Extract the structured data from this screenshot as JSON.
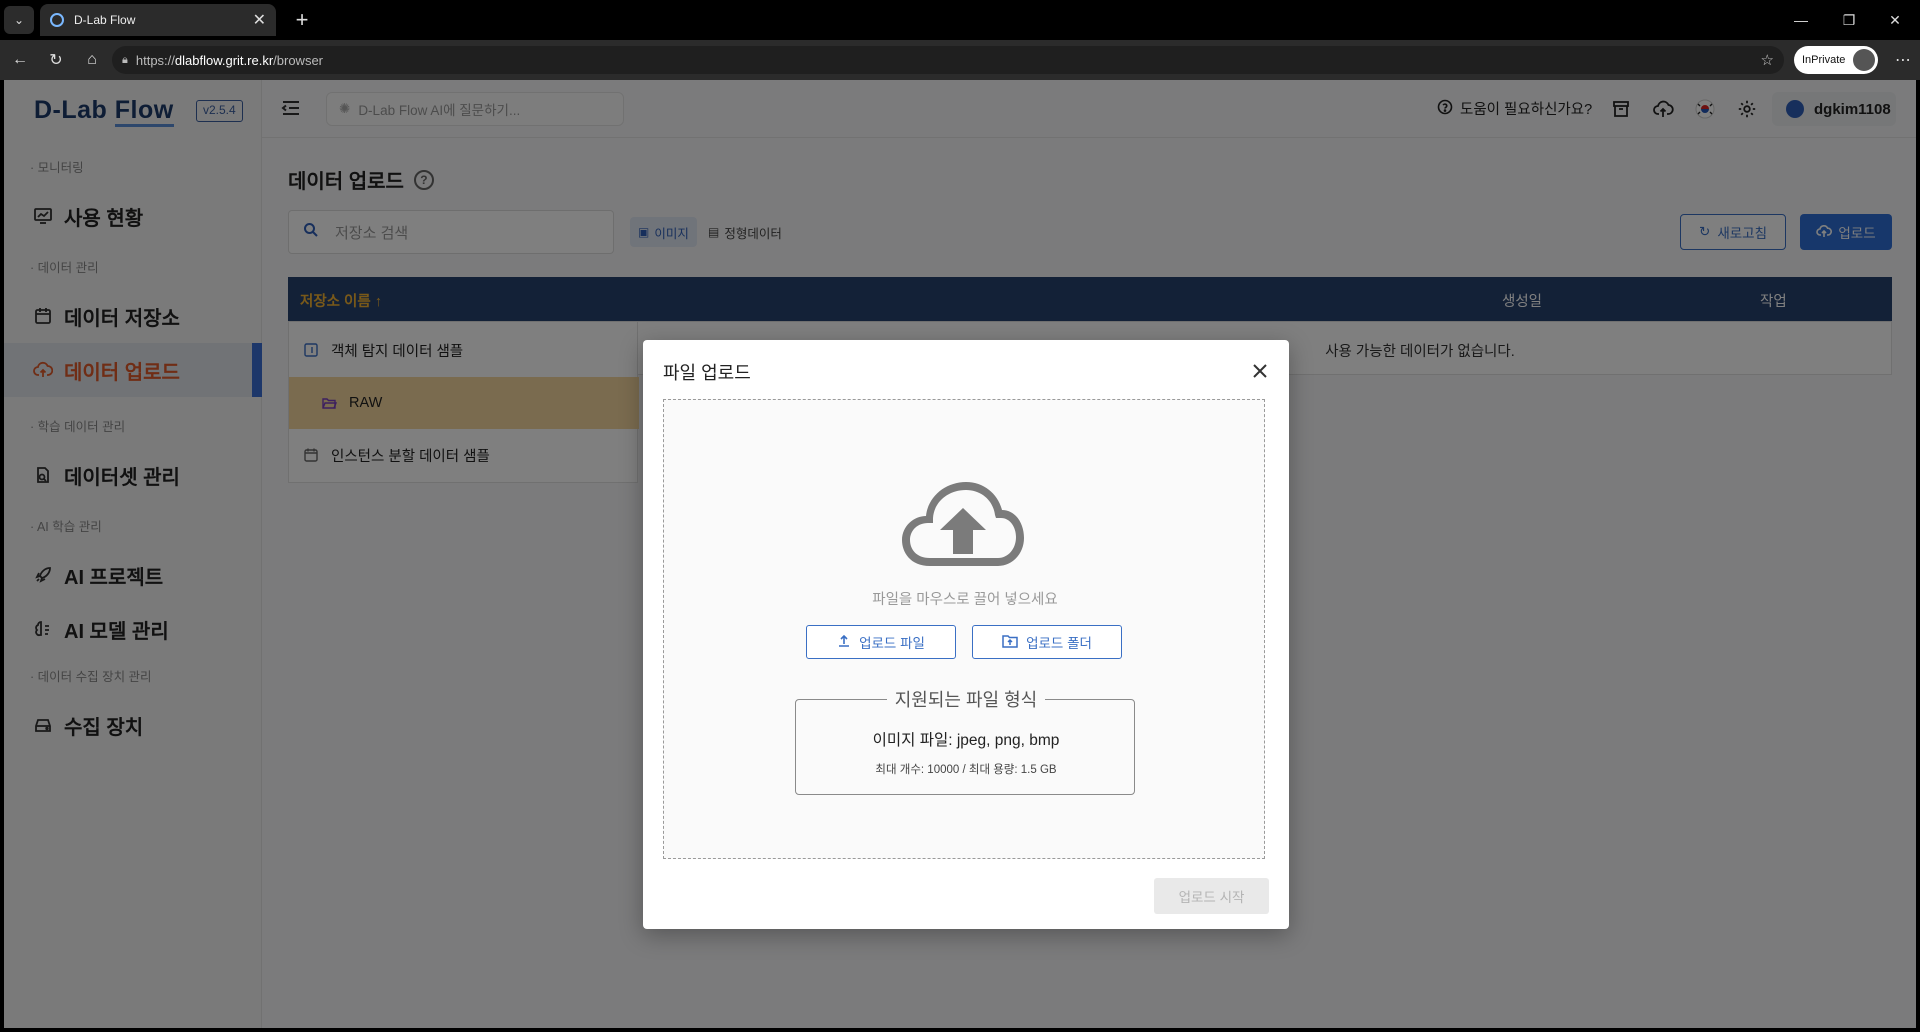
{
  "browser": {
    "tab_title": "D-Lab Flow",
    "url_scheme": "https://",
    "url_host": "dlabflow.grit.re.kr",
    "url_path": "/browser",
    "inprivate_label": "InPrivate"
  },
  "sidebar": {
    "logo": "D-Lab Flow",
    "version": "v2.5.4",
    "categories": [
      "· 모니터링",
      "· 데이터 관리",
      "· 학습 데이터 관리",
      "· AI 학습 관리",
      "· 데이터 수집 장치 관리"
    ],
    "items": [
      {
        "label": "사용 현황",
        "icon": "monitor-chart-icon"
      },
      {
        "label": "데이터 저장소",
        "icon": "calendar-storage-icon"
      },
      {
        "label": "데이터 업로드",
        "icon": "cloud-upload-icon",
        "active": true
      },
      {
        "label": "데이터셋 관리",
        "icon": "dataset-icon"
      },
      {
        "label": "AI 프로젝트",
        "icon": "rocket-icon"
      },
      {
        "label": "AI 모델 관리",
        "icon": "brain-icon"
      },
      {
        "label": "수집 장치",
        "icon": "device-icon"
      }
    ]
  },
  "topbar": {
    "ai_placeholder": "D-Lab Flow AI에 질문하기...",
    "help_label": "도움이 필요하신가요?",
    "username": "dgkim1108"
  },
  "main": {
    "title": "데이터 업로드",
    "search_placeholder": "저장소 검색",
    "filter_image": "이미지",
    "filter_structured": "정형데이터",
    "refresh_label": "새로고침",
    "upload_label": "업로드",
    "columns": {
      "name": "저장소 이름 ↑",
      "created": "생성일",
      "action": "작업"
    },
    "repos": [
      {
        "label": "객체 탐지 데이터 샘플"
      },
      {
        "label": "RAW"
      },
      {
        "label": "인스턴스 분할 데이터 샘플"
      }
    ],
    "empty_message": "사용 가능한 데이터가 없습니다."
  },
  "modal": {
    "title": "파일 업로드",
    "drop_hint": "파일을 마우스로 끌어 넣으세요",
    "upload_file_label": "업로드 파일",
    "upload_folder_label": "업로드 폴더",
    "formats_title": "지원되는 파일 형식",
    "formats_line": "이미지 파일: jpeg, png, bmp",
    "limits_line": "최대 개수: 10000 / 최대 용량: 1.5 GB",
    "start_label": "업로드 시작"
  }
}
